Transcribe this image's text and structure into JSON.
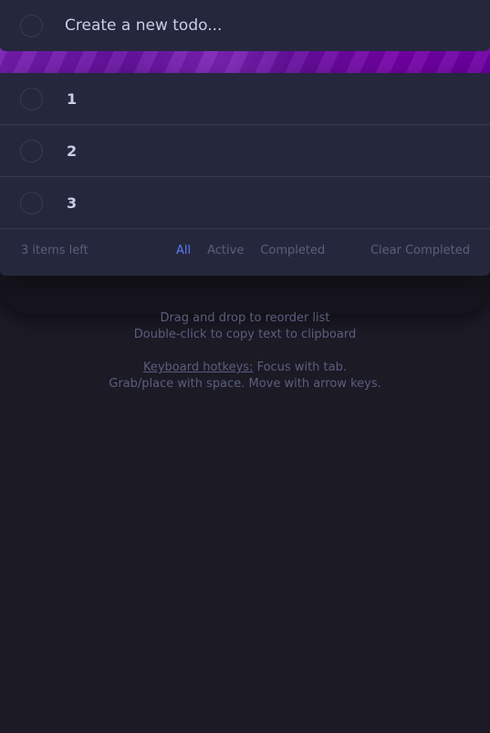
{
  "new_todo": {
    "placeholder": "Create a new todo..."
  },
  "todos": [
    {
      "text": "1"
    },
    {
      "text": "2"
    },
    {
      "text": "3"
    }
  ],
  "footer": {
    "items_left": "3 items left",
    "filters": [
      "All",
      "Active",
      "Completed"
    ],
    "active_filter": "All",
    "clear_label": "Clear Completed"
  },
  "hints": {
    "line1": "Drag and drop to reorder list",
    "line2": "Double-click to copy text to clipboard",
    "hotkeys_link": "Keyboard hotkeys:",
    "hotkeys_rest": " Focus with tab.",
    "line4": "Grab/place with space. Move with arrow keys."
  },
  "colors": {
    "background": "#1b1a25",
    "card": "#25273c",
    "accent": "#5b7bf4",
    "banner": "#6a12a6"
  }
}
